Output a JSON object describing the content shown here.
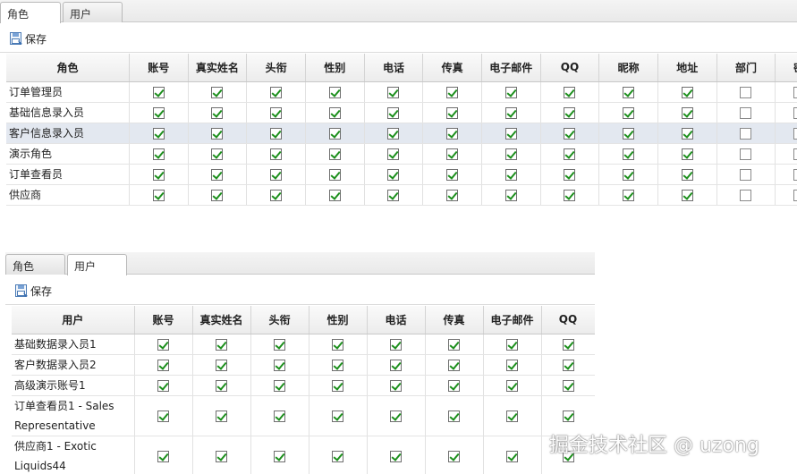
{
  "panel_a": {
    "tabs": [
      {
        "label": "角色",
        "active": true
      },
      {
        "label": "用户",
        "active": false
      }
    ],
    "save_label": "保存",
    "columns": [
      "角色",
      "账号",
      "真实姓名",
      "头衔",
      "性别",
      "电话",
      "传真",
      "电子邮件",
      "QQ",
      "昵称",
      "地址",
      "部门",
      "密"
    ],
    "rows": [
      {
        "name": "订单管理员",
        "checks": [
          true,
          true,
          true,
          true,
          true,
          true,
          true,
          true,
          true,
          true,
          false,
          false
        ],
        "selected": false
      },
      {
        "name": "基础信息录入员",
        "checks": [
          true,
          true,
          true,
          true,
          true,
          true,
          true,
          true,
          true,
          true,
          false,
          false
        ],
        "selected": false
      },
      {
        "name": "客户信息录入员",
        "checks": [
          true,
          true,
          true,
          true,
          true,
          true,
          true,
          true,
          true,
          true,
          false,
          false
        ],
        "selected": true
      },
      {
        "name": "演示角色",
        "checks": [
          true,
          true,
          true,
          true,
          true,
          true,
          true,
          true,
          true,
          true,
          false,
          false
        ],
        "selected": false
      },
      {
        "name": "订单查看员",
        "checks": [
          true,
          true,
          true,
          true,
          true,
          true,
          true,
          true,
          true,
          true,
          false,
          false
        ],
        "selected": false
      },
      {
        "name": "供应商",
        "checks": [
          true,
          true,
          true,
          true,
          true,
          true,
          true,
          true,
          true,
          true,
          false,
          false
        ],
        "selected": false
      }
    ]
  },
  "panel_b": {
    "tabs": [
      {
        "label": "角色",
        "active": false
      },
      {
        "label": "用户",
        "active": true
      }
    ],
    "save_label": "保存",
    "columns": [
      "用户",
      "账号",
      "真实姓名",
      "头衔",
      "性别",
      "电话",
      "传真",
      "电子邮件",
      "QQ"
    ],
    "rows": [
      {
        "name": "基础数据录入员1",
        "checks": [
          true,
          true,
          true,
          true,
          true,
          true,
          true,
          true
        ],
        "tall": false
      },
      {
        "name": "客户数据录入员2",
        "checks": [
          true,
          true,
          true,
          true,
          true,
          true,
          true,
          true
        ],
        "tall": false
      },
      {
        "name": "高级演示账号1",
        "checks": [
          true,
          true,
          true,
          true,
          true,
          true,
          true,
          true
        ],
        "tall": false
      },
      {
        "name": "订单查看员1 - Sales Representative",
        "checks": [
          true,
          true,
          true,
          true,
          true,
          true,
          true,
          true
        ],
        "tall": true
      },
      {
        "name": "供应商1 - Exotic Liquids44",
        "checks": [
          true,
          true,
          true,
          true,
          true,
          true,
          true,
          true
        ],
        "tall": true
      }
    ]
  },
  "watermark": "掘金技术社区 @ uzong",
  "colors": {
    "check": "#1c8f1c",
    "selected_row": "#e3e8f0"
  },
  "icons": {
    "save": "save-icon",
    "checkbox": "checkbox"
  }
}
